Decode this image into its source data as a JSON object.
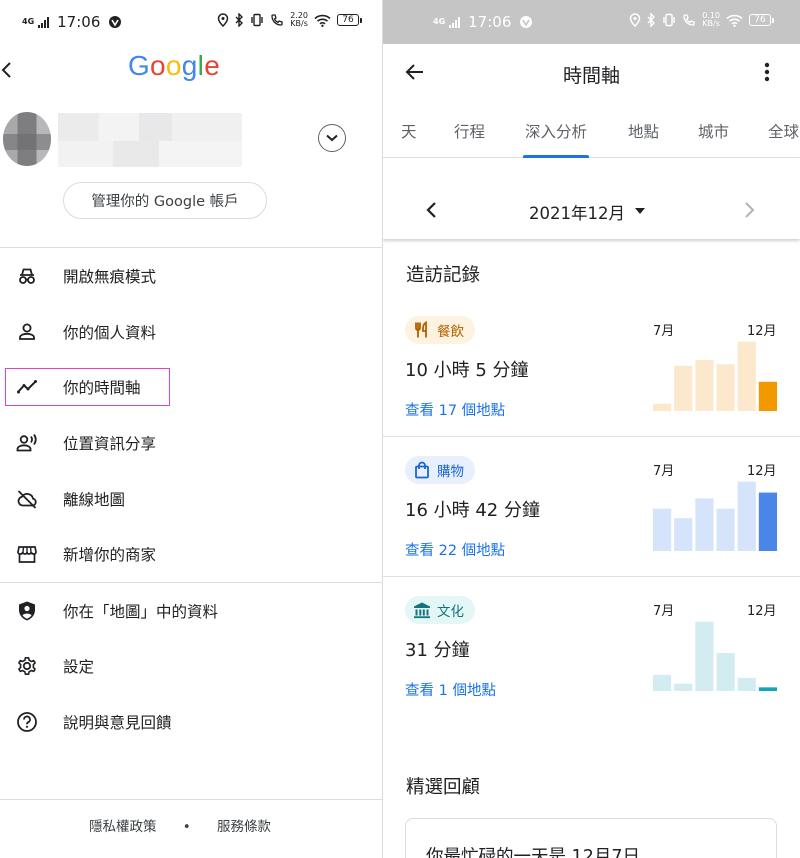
{
  "left": {
    "status": {
      "time": "17:06",
      "network": "4G",
      "speed_value": "2.20",
      "speed_unit": "KB/s",
      "battery": "76"
    },
    "logo": {
      "letters": [
        "G",
        "o",
        "o",
        "g",
        "l",
        "e"
      ],
      "colors": [
        "#4285F4",
        "#EA4335",
        "#FBBC05",
        "#4285F4",
        "#34A853",
        "#EA4335"
      ]
    },
    "manage_account_label": "管理你的 Google 帳戶",
    "menu": [
      {
        "label": "開啟無痕模式",
        "icon": "incognito-icon"
      },
      {
        "label": "你的個人資料",
        "icon": "person-icon"
      },
      {
        "label": "你的時間軸",
        "icon": "timeline-icon"
      },
      {
        "label": "位置資訊分享",
        "icon": "location-sharing-icon"
      },
      {
        "label": "離線地圖",
        "icon": "offline-cloud-icon"
      },
      {
        "label": "新增你的商家",
        "icon": "storefront-icon"
      },
      {
        "label": "你在「地圖」中的資料",
        "icon": "shield-person-icon"
      },
      {
        "label": "設定",
        "icon": "gear-icon"
      },
      {
        "label": "說明與意見回饋",
        "icon": "help-icon"
      }
    ],
    "footer": {
      "privacy": "隱私權政策",
      "separator": "•",
      "terms": "服務條款"
    }
  },
  "right": {
    "status": {
      "time": "17:06",
      "network": "4G",
      "speed_value": "0.10",
      "speed_unit": "KB/s",
      "battery": "76"
    },
    "title": "時間軸",
    "tabs": [
      "天",
      "行程",
      "深入分析",
      "地點",
      "城市",
      "全球"
    ],
    "active_tab_index": 2,
    "month_label": "2021年12月",
    "visits_title": "造訪記錄",
    "categories": [
      {
        "chip_label": "餐飲",
        "chip_icon": "restaurant-icon",
        "chip_bg": "#fef3e0",
        "chip_color": "#b06000",
        "duration": "10 小時 5 分鐘",
        "places_link": "查看 17 個地點",
        "month_start": "7月",
        "month_end": "12月",
        "bar_light": "#fce8cc",
        "bar_dark": "#f29900",
        "values": [
          0.1,
          0.62,
          0.7,
          0.64,
          0.95,
          0.4
        ]
      },
      {
        "chip_label": "購物",
        "chip_icon": "shopping-bag-icon",
        "chip_bg": "#e8f0fe",
        "chip_color": "#1967d2",
        "duration": "16 小時 42 分鐘",
        "places_link": "查看 22 個地點",
        "month_start": "7月",
        "month_end": "12月",
        "bar_light": "#d6e4fb",
        "bar_dark": "#4a86e8",
        "values": [
          0.58,
          0.45,
          0.72,
          0.58,
          0.95,
          0.8
        ]
      },
      {
        "chip_label": "文化",
        "chip_icon": "museum-icon",
        "chip_bg": "#e4f7f6",
        "chip_color": "#12737f",
        "duration": "31 分鐘",
        "places_link": "查看 1 個地點",
        "month_start": "7月",
        "month_end": "12月",
        "bar_light": "#d2ecf2",
        "bar_dark": "#12a4b8",
        "values": [
          0.22,
          0.1,
          0.95,
          0.52,
          0.18,
          0.05
        ]
      }
    ],
    "featured_title": "精選回顧",
    "featured_text": "你最忙碌的一天是 12月7日"
  }
}
